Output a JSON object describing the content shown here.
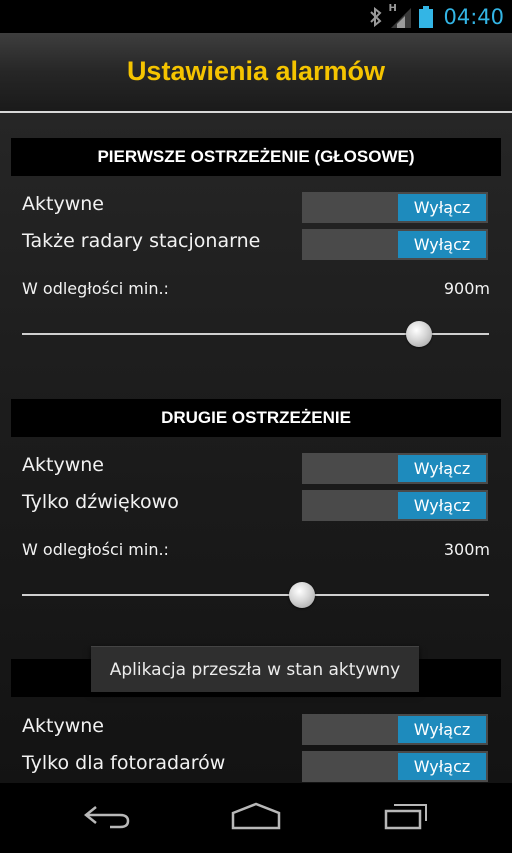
{
  "status_bar": {
    "time": "04:40",
    "network_letter": "H",
    "icons": [
      "bluetooth-icon",
      "signal-icon",
      "battery-icon"
    ]
  },
  "title": "Ustawienia alarmów",
  "sections": [
    {
      "header": "PIERWSZE OSTRZEŻENIE (GŁOSOWE)",
      "rows": [
        {
          "label": "Aktywne",
          "button": "Wyłącz"
        },
        {
          "label": "Także radary stacjonarne",
          "button": "Wyłącz"
        }
      ],
      "distance_label": "W odległości min.:",
      "distance_value": "900m",
      "slider_fraction": 0.85
    },
    {
      "header": "DRUGIE OSTRZEŻENIE",
      "rows": [
        {
          "label": "Aktywne",
          "button": "Wyłącz"
        },
        {
          "label": "Tylko dźwiękowo",
          "button": "Wyłącz"
        }
      ],
      "distance_label": "W odległości min.:",
      "distance_value": "300m",
      "slider_fraction": 0.6
    },
    {
      "header": "",
      "rows": [
        {
          "label": "Aktywne",
          "button": "Wyłącz"
        },
        {
          "label": "Tylko dla fotoradarów",
          "button": "Wyłącz"
        }
      ]
    }
  ],
  "toast": "Aplikacja przeszła w stan aktywny",
  "navbar": {
    "icons": [
      "back-icon",
      "home-icon",
      "recent-apps-icon"
    ]
  },
  "colors": {
    "title": "#f5c400",
    "toggle_button": "#1e8bbd",
    "status_time": "#33b5e5"
  }
}
